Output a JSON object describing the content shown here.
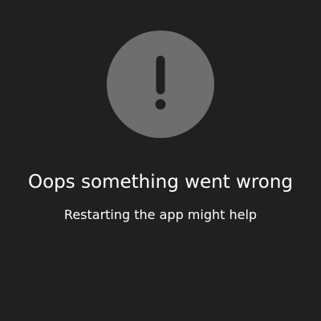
{
  "error_screen": {
    "icon": "exclamation-icon",
    "title": "Oops something went wrong",
    "message": "Restarting the app might help"
  },
  "colors": {
    "background": "#202020",
    "icon_circle": "#6e6e6e",
    "icon_mark": "#202020",
    "text": "#ffffff"
  }
}
